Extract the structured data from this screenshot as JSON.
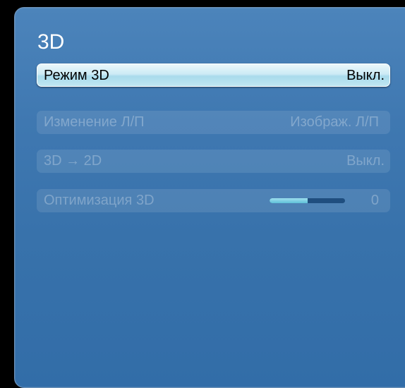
{
  "menu": {
    "title": "3D",
    "items": [
      {
        "label": "Режим 3D",
        "value": "Выкл.",
        "selected": true,
        "enabled": true
      },
      {
        "label": "Изменение Л/П",
        "value": "Изображ. Л/П",
        "selected": false,
        "enabled": false
      },
      {
        "label": "3D → 2D",
        "value": "Выкл.",
        "selected": false,
        "enabled": false
      },
      {
        "label": "Оптимизация 3D",
        "value": "0",
        "selected": false,
        "enabled": false,
        "slider_level": 0.5
      }
    ]
  },
  "colors": {
    "panel": "#3f78b1",
    "highlight": "#cdebf5",
    "slider_fill": "#5fc0d8",
    "slider_track": "#1f4e7f"
  }
}
